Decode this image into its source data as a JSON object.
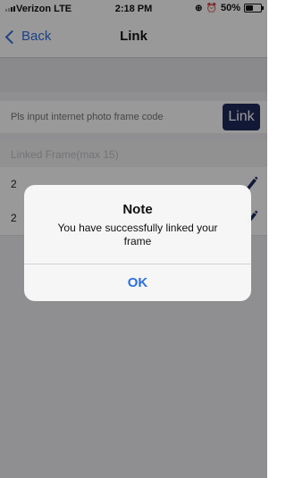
{
  "status_bar": {
    "carrier": "Verizon LTE",
    "time": "2:18 PM",
    "battery_text": "50%",
    "battery_level": 0.5
  },
  "nav": {
    "back_label": "Back",
    "title": "Link"
  },
  "code_input": {
    "placeholder": "Pls input internet photo frame code",
    "value": ""
  },
  "link_button_label": "Link",
  "section_header": "Linked Frame(max 15)",
  "frames": [
    {
      "name": "2"
    },
    {
      "name": "2"
    }
  ],
  "alert": {
    "title": "Note",
    "message": "You have successfully linked your frame",
    "ok_label": "OK"
  },
  "colors": {
    "accent": "#2f6fe0",
    "link_button": "#1f2a5c"
  }
}
